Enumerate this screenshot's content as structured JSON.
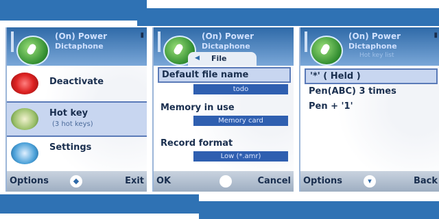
{
  "app": {
    "title_line1": "(On) Power",
    "title_line2": "Dictaphone"
  },
  "screen1": {
    "menu": [
      {
        "label": "Deactivate",
        "sub": ""
      },
      {
        "label": "Hot key",
        "sub": "(3 hot keys)"
      },
      {
        "label": "Settings",
        "sub": ""
      }
    ],
    "softkeys": {
      "left": "Options",
      "right": "Exit"
    }
  },
  "screen2": {
    "tab": "File",
    "fields": [
      {
        "label": "Default file name",
        "value": "todo"
      },
      {
        "label": "Memory in use",
        "value": "Memory card"
      },
      {
        "label": "Record format",
        "value": "Low (*.amr)"
      }
    ],
    "softkeys": {
      "left": "OK",
      "right": "Cancel"
    }
  },
  "screen3": {
    "subtitle": "Hot key list",
    "items": [
      "'*' ( Held )",
      "Pen(ABC) 3 times",
      "Pen + '1'"
    ],
    "softkeys": {
      "left": "Options",
      "right": "Back"
    }
  }
}
